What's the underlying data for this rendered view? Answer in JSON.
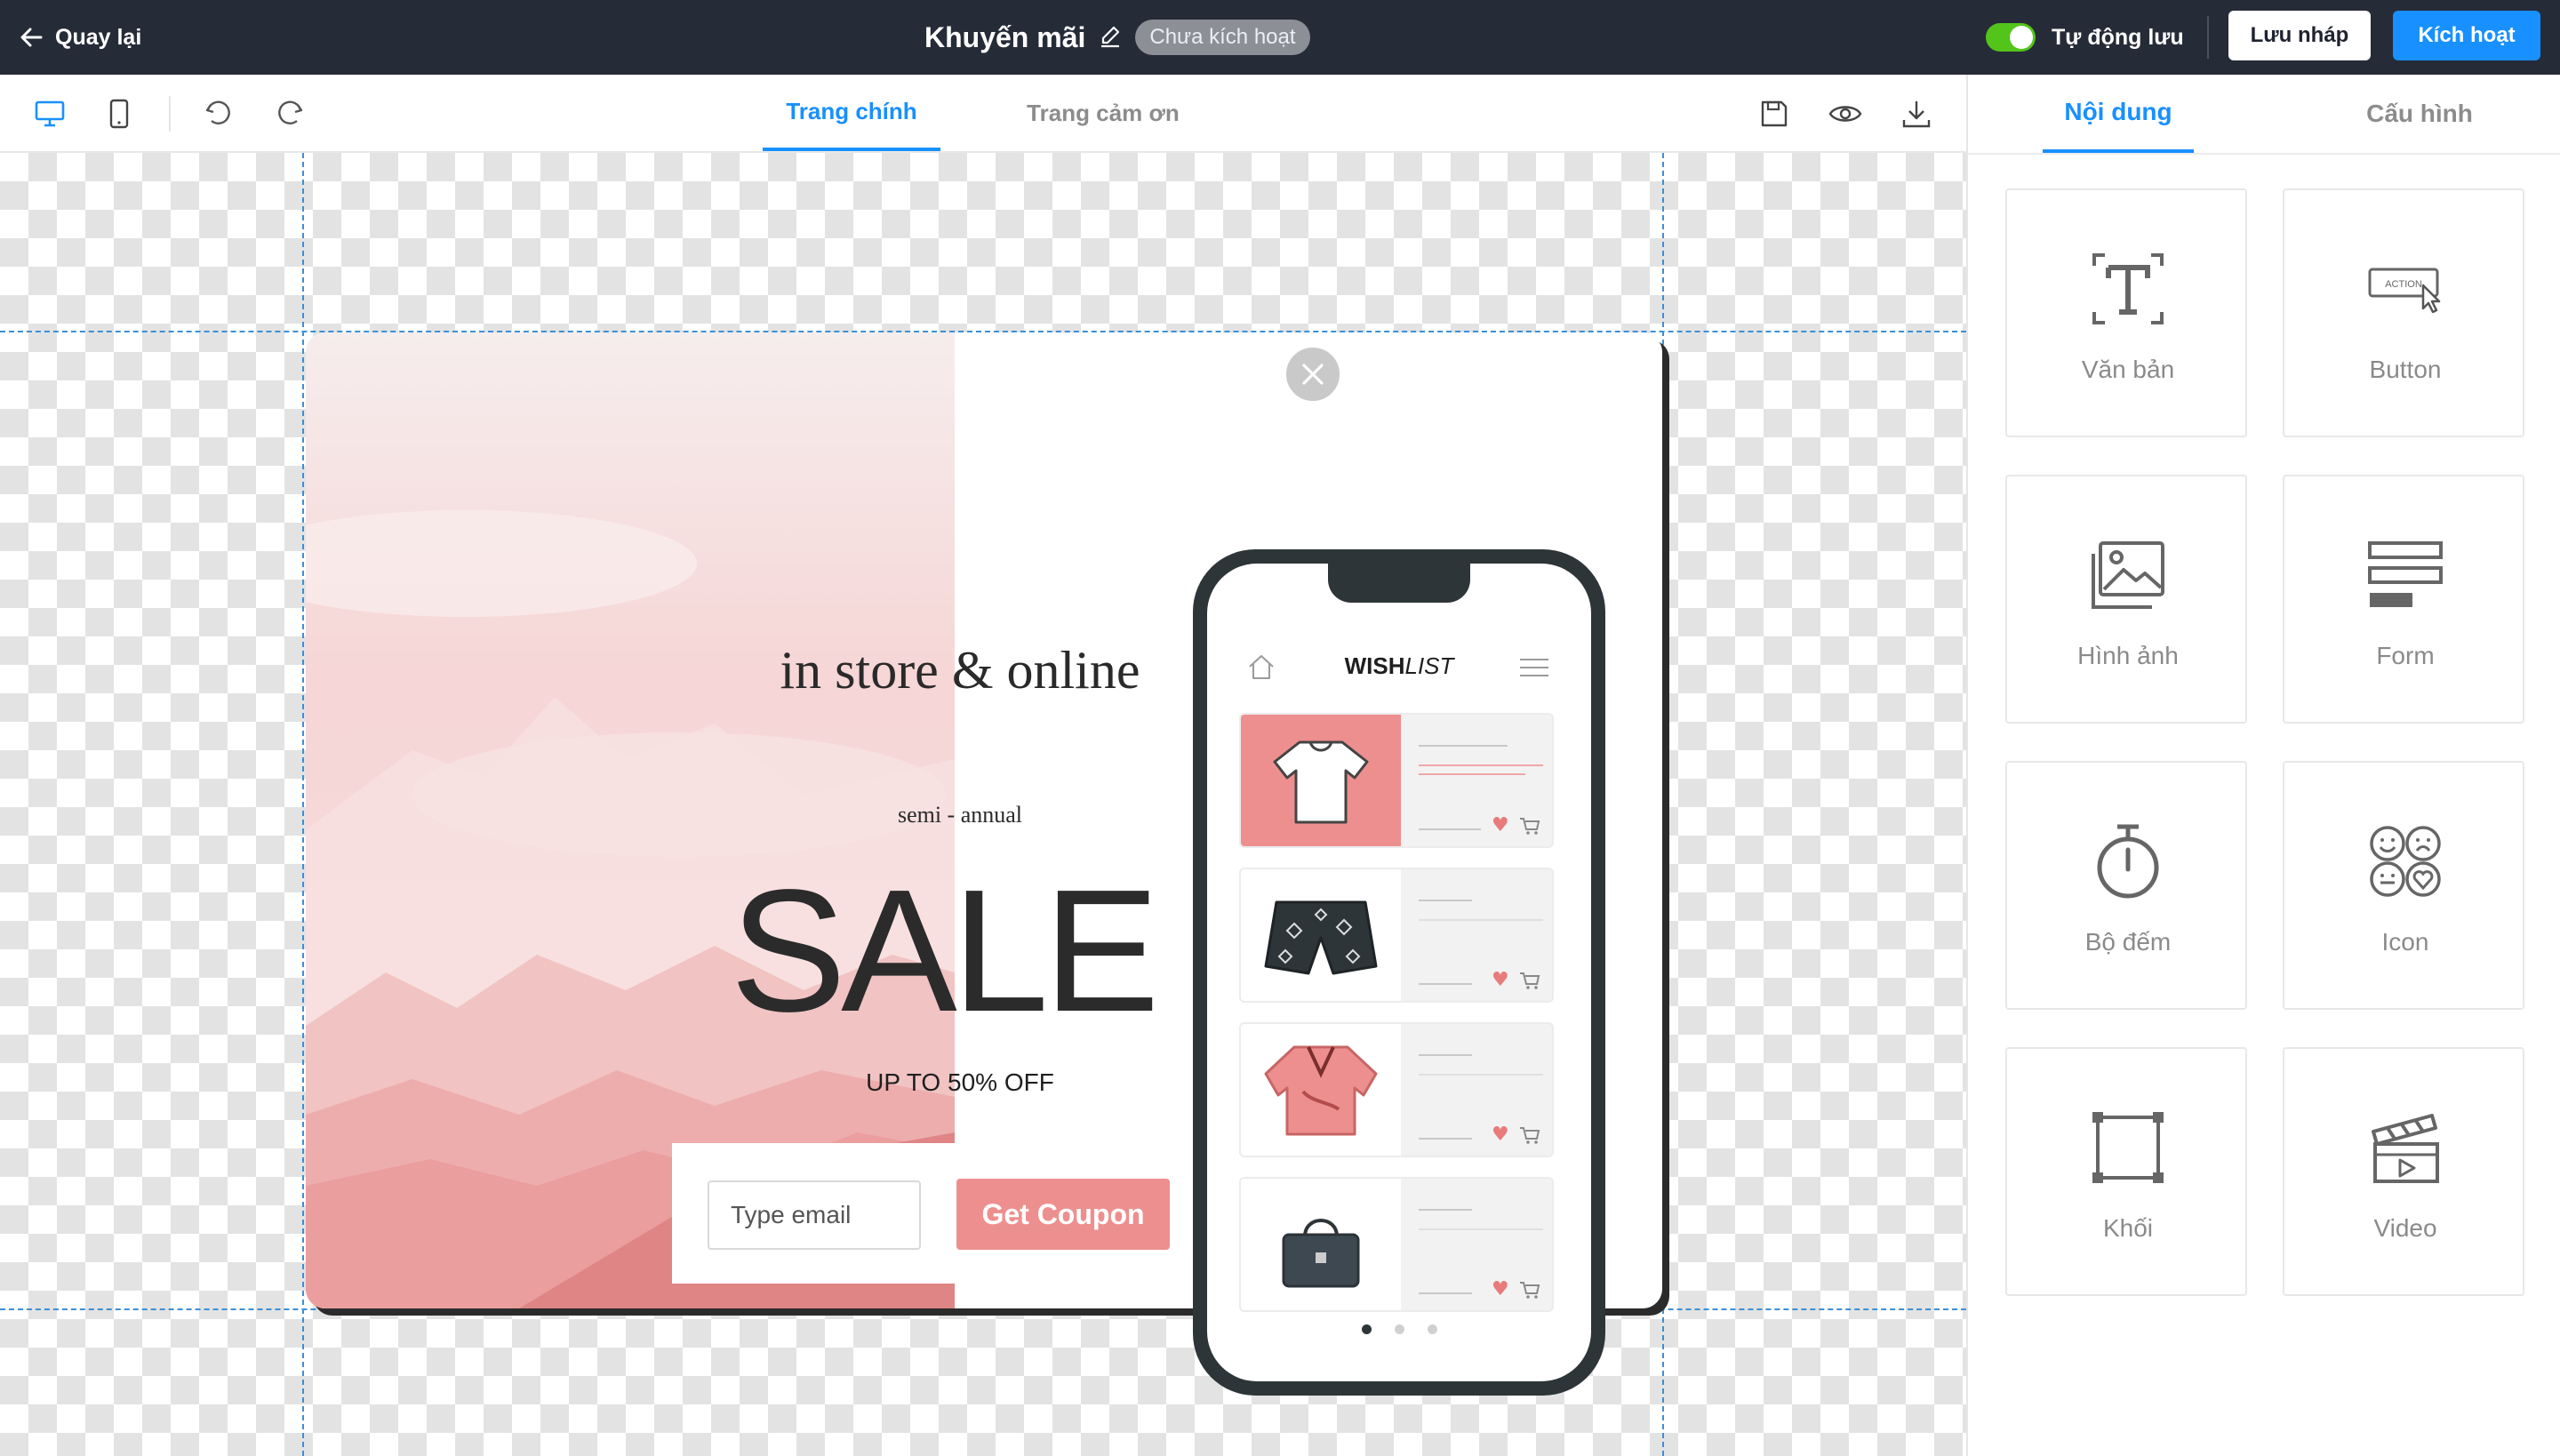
{
  "header": {
    "back_label": "Quay lại",
    "title": "Khuyến mãi",
    "status": "Chưa kích hoạt",
    "autosave_label": "Tự động lưu",
    "autosave_on": true,
    "draft_label": "Lưu nháp",
    "activate_label": "Kích hoạt"
  },
  "toolbar": {
    "tabs": [
      {
        "label": "Trang chính",
        "active": true
      },
      {
        "label": "Trang cảm ơn",
        "active": false
      }
    ]
  },
  "popup": {
    "headline": "in store & online",
    "subhead": "semi - annual",
    "sale": "SALE",
    "offer": "UP TO 50% OFF",
    "email_placeholder": "Type email",
    "coupon_label": "Get Coupon",
    "phone": {
      "title_bold": "WISH",
      "title_italic": "LIST",
      "items": [
        "t-shirt",
        "shorts",
        "shirt",
        "handbag"
      ],
      "page_dots": 3,
      "active_dot": 1
    }
  },
  "panel": {
    "tabs": [
      {
        "label": "Nội dung",
        "active": true
      },
      {
        "label": "Cấu hình",
        "active": false
      }
    ],
    "elements": [
      {
        "label": "Văn bản",
        "icon": "text-icon"
      },
      {
        "label": "Button",
        "icon": "button-icon"
      },
      {
        "label": "Hình ảnh",
        "icon": "image-icon"
      },
      {
        "label": "Form",
        "icon": "form-icon"
      },
      {
        "label": "Bộ đếm",
        "icon": "timer-icon"
      },
      {
        "label": "Icon",
        "icon": "emoji-icon"
      },
      {
        "label": "Khối",
        "icon": "block-icon"
      },
      {
        "label": "Video",
        "icon": "video-icon"
      }
    ]
  },
  "colors": {
    "topbar": "#262b38",
    "accent": "#1890ff",
    "toggle_on": "#52c41a",
    "coupon": "#ee8f8f",
    "phone": "#2e3538"
  }
}
